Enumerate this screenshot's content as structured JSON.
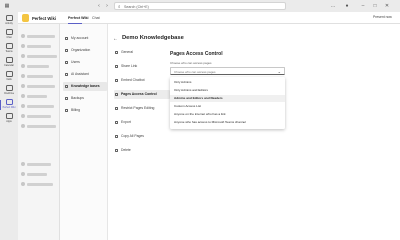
{
  "search": {
    "placeholder": "Search (Ctrl+E)"
  },
  "app_header": {
    "app_name": "Perfect Wiki",
    "tabs": [
      "Perfect Wiki",
      "Chat"
    ],
    "present_label": "Present now"
  },
  "rail": [
    "Activity",
    "Chat",
    "Teams",
    "Calendar",
    "Calls",
    "OneDrive",
    "Perfect Wiki",
    "Apps"
  ],
  "left_nav": {
    "items": [
      "My account",
      "Organization",
      "Users",
      "AI Assistant",
      "Knowledge bases",
      "Backups",
      "Billing"
    ]
  },
  "kb": {
    "title": "Demo Knowledgebase"
  },
  "settings_nav": {
    "items": [
      "General",
      "Share Link",
      "Embed Chatbot",
      "Pages Access Control",
      "Restrict Pages Editing",
      "Export",
      "Copy All Pages",
      "Delete"
    ]
  },
  "pages_access": {
    "heading": "Pages Access Control",
    "sub": "Choose who can access pages",
    "placeholder": "Choose who can access pages",
    "options": [
      "Only Admins",
      "Only Admins and Editors",
      "Admins and Editors and Readers",
      "Custom Access List",
      "Anyone on the internet who has a link",
      "Anyone who has access to Microsoft Teams channel"
    ],
    "selected_index": 2
  },
  "colors": {
    "accent": "#5b5fc7",
    "logo": "#f4c542"
  }
}
